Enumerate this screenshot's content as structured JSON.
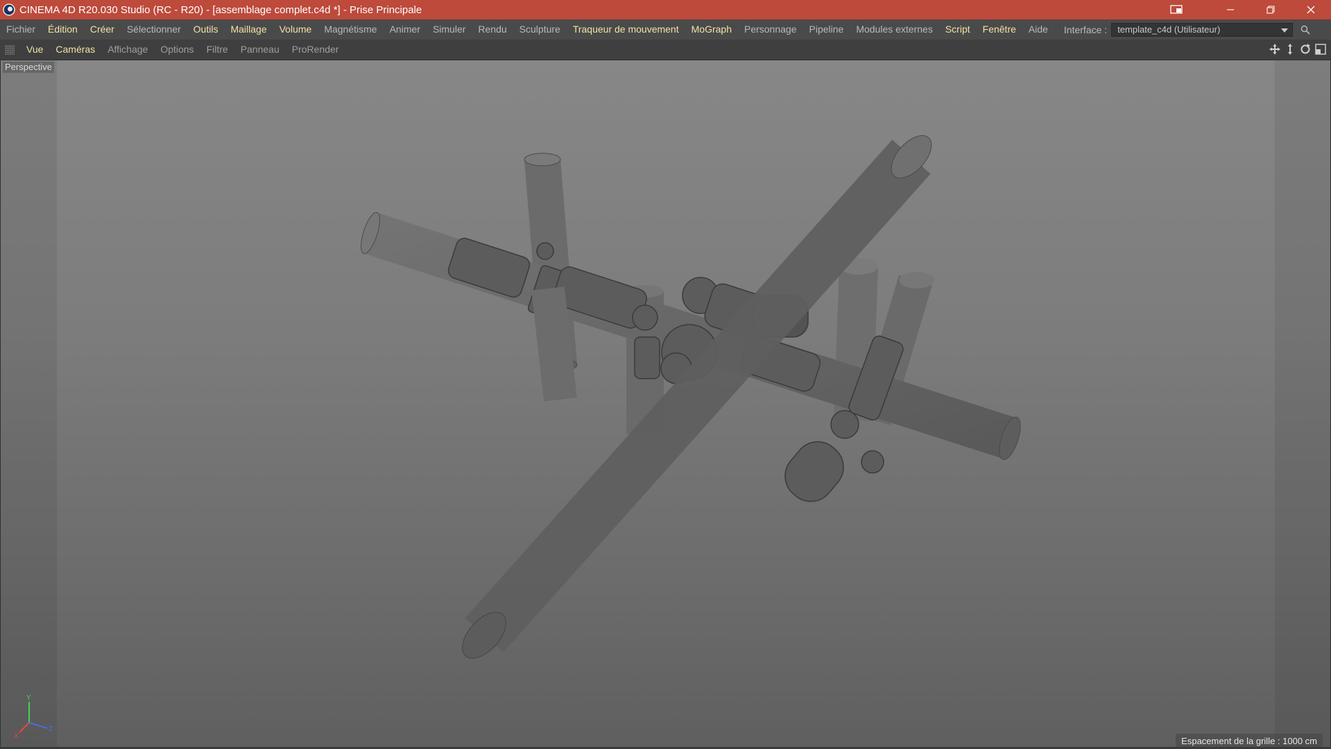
{
  "window": {
    "title": "CINEMA 4D R20.030 Studio (RC - R20) - [assemblage complet.c4d *] - Prise Principale",
    "logo_icon": "cinema4d-logo-icon",
    "controls": [
      "minimize-icon",
      "restore-icon",
      "close-icon"
    ],
    "title_bar_color": "#bd4a3b"
  },
  "menu": {
    "items": [
      {
        "label": "Fichier",
        "highlight": false
      },
      {
        "label": "Édition",
        "highlight": true
      },
      {
        "label": "Créer",
        "highlight": true
      },
      {
        "label": "Sélectionner",
        "highlight": false
      },
      {
        "label": "Outils",
        "highlight": true
      },
      {
        "label": "Maillage",
        "highlight": true
      },
      {
        "label": "Volume",
        "highlight": true
      },
      {
        "label": "Magnétisme",
        "highlight": false
      },
      {
        "label": "Animer",
        "highlight": false
      },
      {
        "label": "Simuler",
        "highlight": false
      },
      {
        "label": "Rendu",
        "highlight": false
      },
      {
        "label": "Sculpture",
        "highlight": false
      },
      {
        "label": "Traqueur de mouvement",
        "highlight": true
      },
      {
        "label": "MoGraph",
        "highlight": true
      },
      {
        "label": "Personnage",
        "highlight": false
      },
      {
        "label": "Pipeline",
        "highlight": false
      },
      {
        "label": "Modules externes",
        "highlight": false
      },
      {
        "label": "Script",
        "highlight": true
      },
      {
        "label": "Fenêtre",
        "highlight": true
      },
      {
        "label": "Aide",
        "highlight": false
      }
    ],
    "interface_label": "Interface :",
    "interface_value": "template_c4d (Utilisateur)",
    "highlight_color": "#f1e1a6"
  },
  "viewbar": {
    "items": [
      {
        "label": "Vue",
        "highlight": true
      },
      {
        "label": "Caméras",
        "highlight": true
      },
      {
        "label": "Affichage",
        "highlight": false
      },
      {
        "label": "Options",
        "highlight": false
      },
      {
        "label": "Filtre",
        "highlight": false
      },
      {
        "label": "Panneau",
        "highlight": false
      },
      {
        "label": "ProRender",
        "highlight": false
      }
    ],
    "nav_icons": [
      "move-view-icon",
      "zoom-view-icon",
      "rotate-view-icon",
      "maximize-view-icon"
    ]
  },
  "viewport": {
    "camera_label": "Perspective",
    "grid_spacing": "Espacement de la grille : 1000 cm",
    "axis_labels": {
      "x": "X",
      "y": "Y",
      "z": "Z"
    }
  }
}
